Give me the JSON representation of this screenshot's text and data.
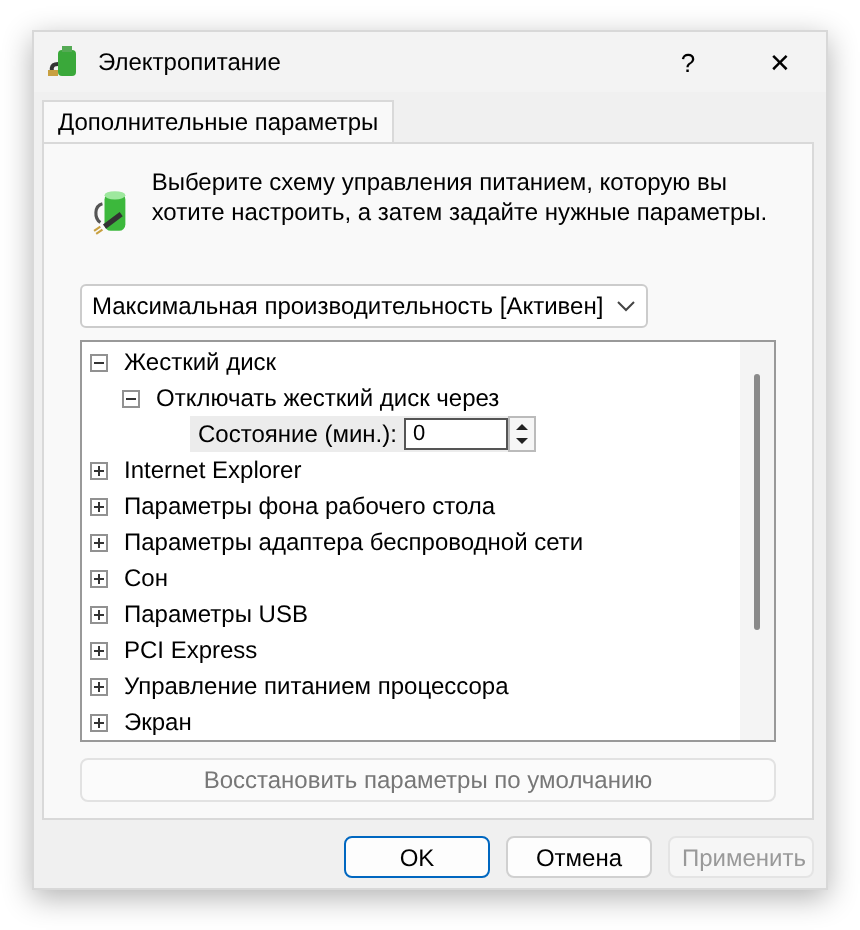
{
  "window": {
    "title": "Электропитание",
    "help": "?",
    "close": "✕"
  },
  "tabs": [
    {
      "label": "Дополнительные параметры",
      "selected": true
    }
  ],
  "description": "Выберите схему управления питанием, которую вы хотите настроить, а затем задайте нужные параметры.",
  "plan_dropdown": {
    "value": "Максимальная производительность [Активен]"
  },
  "tree": [
    {
      "kind": "node",
      "label": "Жесткий диск",
      "expanded": true,
      "children": [
        {
          "kind": "node",
          "label": "Отключать жесткий диск через",
          "expanded": true,
          "children": [
            {
              "kind": "spin",
              "label": "Состояние (мин.):",
              "value": "0"
            }
          ]
        }
      ]
    },
    {
      "kind": "node",
      "label": "Internet Explorer",
      "expanded": false
    },
    {
      "kind": "node",
      "label": "Параметры фона рабочего стола",
      "expanded": false
    },
    {
      "kind": "node",
      "label": "Параметры адаптера беспроводной сети",
      "expanded": false
    },
    {
      "kind": "node",
      "label": "Сон",
      "expanded": false
    },
    {
      "kind": "node",
      "label": "Параметры USB",
      "expanded": false
    },
    {
      "kind": "node",
      "label": "PCI Express",
      "expanded": false
    },
    {
      "kind": "node",
      "label": "Управление питанием процессора",
      "expanded": false
    },
    {
      "kind": "node",
      "label": "Экран",
      "expanded": false
    }
  ],
  "restore_button": {
    "label": "Восстановить параметры по умолчанию",
    "disabled": true
  },
  "buttons": [
    {
      "label": "OK",
      "default": true,
      "disabled": false
    },
    {
      "label": "Отмена",
      "default": false,
      "disabled": false
    },
    {
      "label": "Применить",
      "default": false,
      "disabled": true
    }
  ]
}
